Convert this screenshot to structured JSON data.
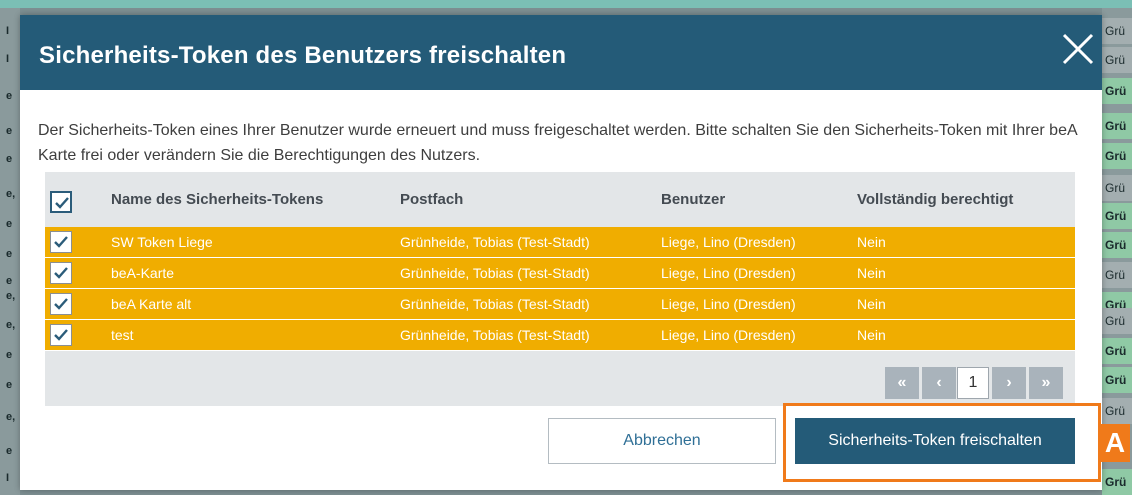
{
  "dialog": {
    "title": "Sicherheits-Token des Benutzers freischalten",
    "message": "Der Sicherheits-Token eines Ihrer Benutzer wurde erneuert und muss freigeschaltet werden. Bitte schalten Sie den Sicherheits-Token mit Ihrer beA Karte frei oder verändern Sie die Berechtigungen des Nutzers."
  },
  "table": {
    "select_all_checked": true,
    "columns": [
      "Name des Sicherheits-Tokens",
      "Postfach",
      "Benutzer",
      "Vollständig berechtigt"
    ],
    "rows": [
      {
        "checked": true,
        "name": "SW Token Liege",
        "postfach": "Grünheide, Tobias (Test-Stadt)",
        "benutzer": "Liege, Lino (Dresden)",
        "berechtigt": "Nein"
      },
      {
        "checked": true,
        "name": "beA-Karte",
        "postfach": "Grünheide, Tobias (Test-Stadt)",
        "benutzer": "Liege, Lino (Dresden)",
        "berechtigt": "Nein"
      },
      {
        "checked": true,
        "name": "beA Karte alt",
        "postfach": "Grünheide, Tobias (Test-Stadt)",
        "benutzer": "Liege, Lino (Dresden)",
        "berechtigt": "Nein"
      },
      {
        "checked": true,
        "name": "test",
        "postfach": "Grünheide, Tobias (Test-Stadt)",
        "benutzer": "Liege, Lino (Dresden)",
        "berechtigt": "Nein"
      }
    ],
    "row_color": "#f0ad00"
  },
  "pagination": {
    "first": "«",
    "prev": "‹",
    "current_page": "1",
    "next": "›",
    "last": "»"
  },
  "buttons": {
    "cancel": "Abbrechen",
    "confirm": "Sicherheits-Token freischalten"
  },
  "annotation": {
    "label": "A",
    "color": "#f07a1a"
  },
  "background": {
    "left_rows": [
      "I",
      "I",
      "e",
      "e",
      "e",
      "e,",
      "e",
      "e",
      "e",
      "e,",
      "e,",
      "e",
      "e",
      "e,",
      "e",
      "I"
    ],
    "right_rows": [
      "Grü",
      "Grü",
      "Grü",
      "Grü",
      "Grü",
      "Grü",
      "Grü",
      "Grü",
      "Grü",
      "Grü",
      "Grü",
      "Grü",
      "Grü",
      "Grü",
      "Grü",
      "Grü",
      "Grü"
    ]
  },
  "colors": {
    "header": "#245b78",
    "accent_link": "#2f6f96"
  }
}
